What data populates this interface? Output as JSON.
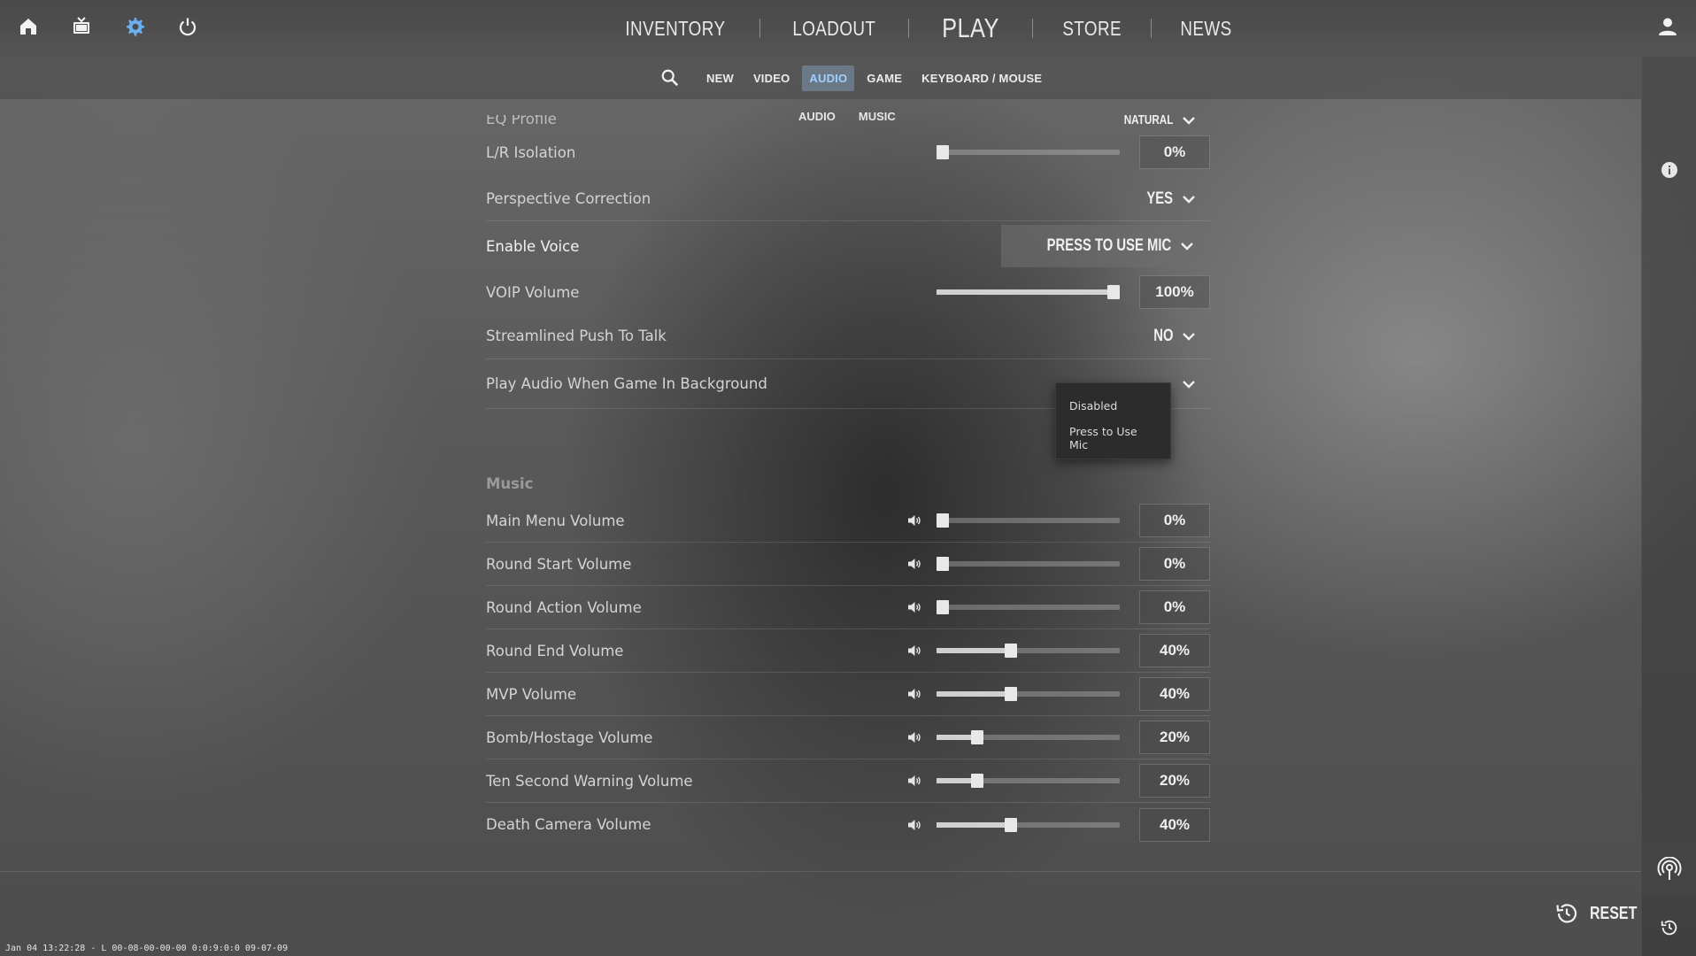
{
  "topbar": {
    "icons": [
      "home-icon",
      "tv-icon",
      "gear-icon",
      "power-icon"
    ],
    "nav": [
      "INVENTORY",
      "LOADOUT",
      "PLAY",
      "STORE",
      "NEWS"
    ],
    "profile_icon": "user-icon"
  },
  "tabs": {
    "search_icon": "search-icon",
    "items": [
      "NEW",
      "VIDEO",
      "AUDIO",
      "GAME",
      "KEYBOARD / MOUSE"
    ],
    "active": "AUDIO",
    "sub": [
      "AUDIO",
      "MUSIC"
    ]
  },
  "settings": {
    "partial_row": {
      "label": "EQ Profile",
      "value": "NATURAL"
    },
    "lr_isolation": {
      "label": "L/R Isolation",
      "value": "0%",
      "level": 0
    },
    "perspective": {
      "label": "Perspective Correction",
      "value": "YES"
    },
    "enable_voice": {
      "label": "Enable Voice",
      "value": "PRESS TO USE MIC"
    },
    "voip_volume": {
      "label": "VOIP Volume",
      "value": "100%",
      "level": 100
    },
    "streamlined_ptt": {
      "label": "Streamlined Push To Talk",
      "value": "NO"
    },
    "background_audio": {
      "label": "Play Audio When Game In Background"
    }
  },
  "voice_menu": {
    "options": [
      "Disabled",
      "Press to Use Mic"
    ]
  },
  "music": {
    "title": "Music",
    "rows": [
      {
        "label": "Main Menu Volume",
        "value": "0%",
        "level": 0
      },
      {
        "label": "Round Start Volume",
        "value": "0%",
        "level": 0
      },
      {
        "label": "Round Action Volume",
        "value": "0%",
        "level": 0
      },
      {
        "label": "Round End Volume",
        "value": "40%",
        "level": 40
      },
      {
        "label": "MVP Volume",
        "value": "40%",
        "level": 40
      },
      {
        "label": "Bomb/Hostage Volume",
        "value": "20%",
        "level": 20
      },
      {
        "label": "Ten Second Warning Volume",
        "value": "20%",
        "level": 20
      },
      {
        "label": "Death Camera Volume",
        "value": "40%",
        "level": 40
      }
    ]
  },
  "footer": {
    "reset_label": "RESET",
    "status": "Jan 04 13:22:28 - L 00-08-00-00-00 0:0:9:0:0 09-07-09"
  },
  "colors": {
    "accent": "#9fd0ff",
    "gear": "#6ab0f0"
  }
}
